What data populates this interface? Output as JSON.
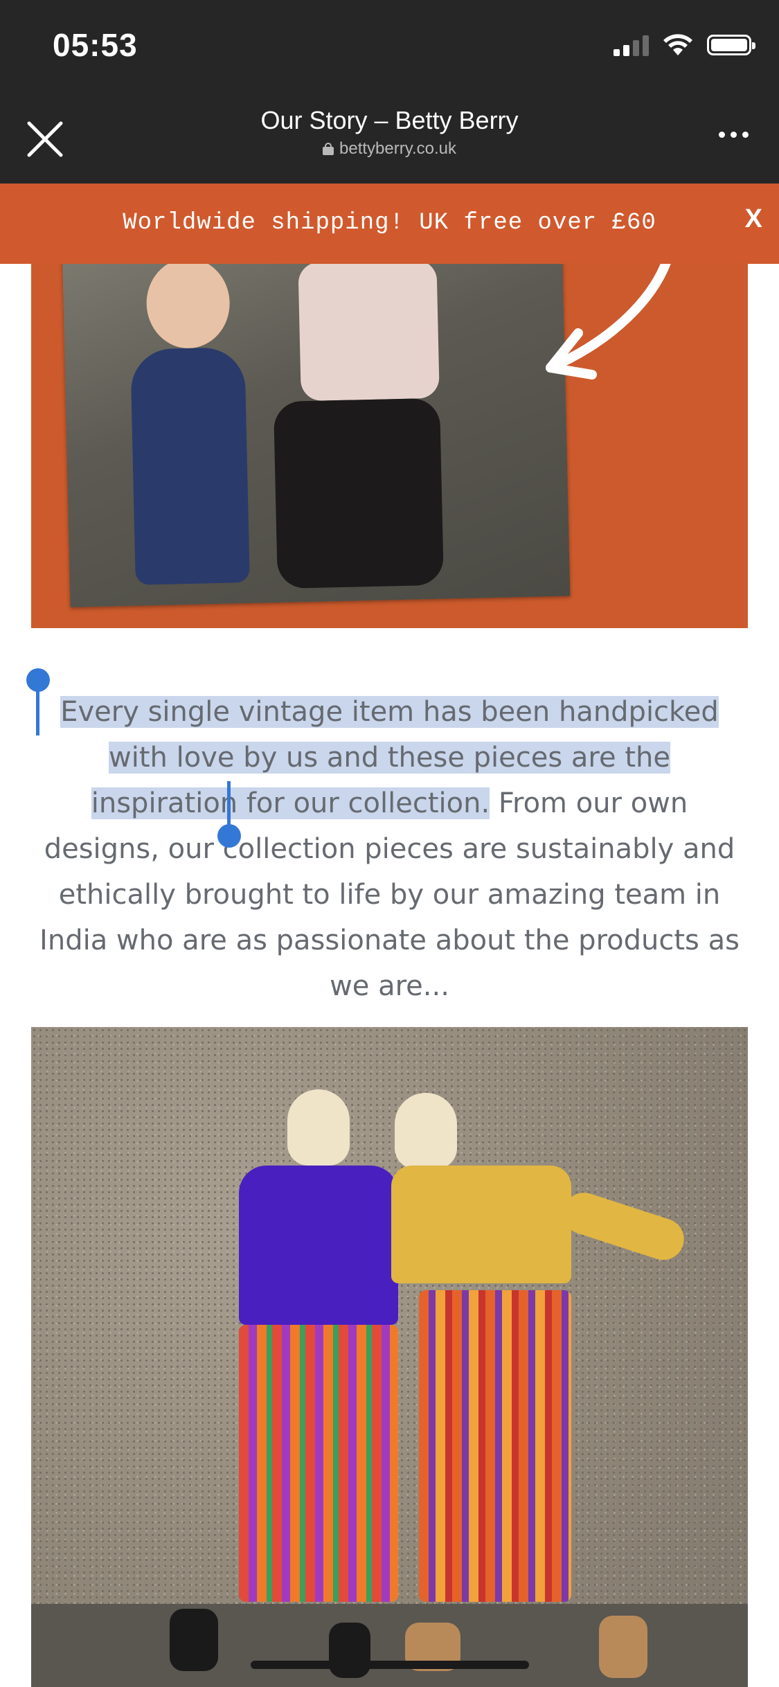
{
  "status_bar": {
    "time": "05:53"
  },
  "nav": {
    "title": "Our Story – Betty Berry",
    "domain": "bettyberry.co.uk"
  },
  "announcement": {
    "text": "Worldwide shipping! UK free over £60",
    "close": "X"
  },
  "content": {
    "paragraph_selected": "Every single vintage item has been handpicked with love by us and these pieces are the inspiration for our collection.",
    "paragraph_rest": " From our own designs, our collection pieces are sustainably and ethically brought to life by our amazing team in India who are as passionate about the products as we are..."
  },
  "colors": {
    "accent_orange": "#d05a2e",
    "selection": "#c9d6ec",
    "handle_blue": "#3478d6",
    "chrome": "#262626"
  },
  "icons": [
    "close-icon",
    "lock-icon",
    "more-icon",
    "signal-icon",
    "wifi-icon",
    "battery-icon"
  ]
}
